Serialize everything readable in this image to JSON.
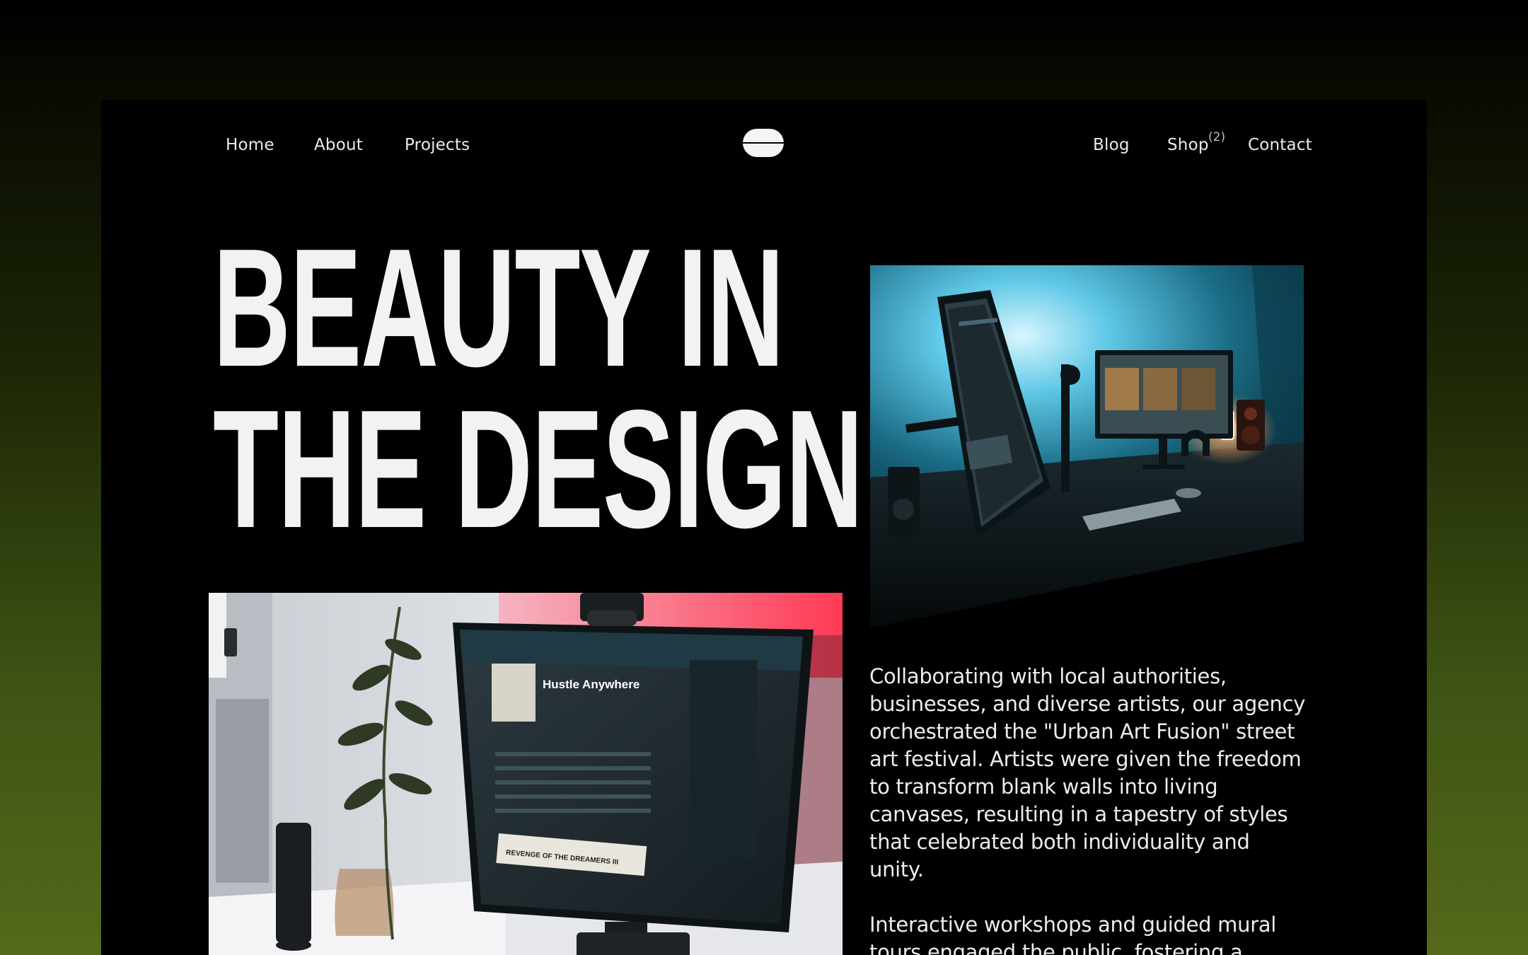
{
  "nav": {
    "home": "Home",
    "about": "About",
    "projects": "Projects",
    "blog": "Blog",
    "shop": "Shop",
    "shop_count": "(2)",
    "contact": "Contact"
  },
  "hero": {
    "line1": "BEAUTY IN",
    "line2": "THE DESIGN"
  },
  "body": {
    "paragraph1": "Collaborating with local authorities, businesses, and diverse artists, our agency orchestrated the \"Urban Art Fusion\" street art festival. Artists were given the freedom to transform blank walls into living canvases, resulting in a tapestry of styles that celebrated both individuality and unity.",
    "paragraph2": "Interactive workshops and guided mural tours engaged the public, fostering a"
  },
  "images": {
    "right": "desk-setup-blue-photo",
    "left": "monitor-music-app-photo",
    "screen_title": "Hustle Anywhere",
    "screen_banner": "REVENGE OF THE DREAMERS III"
  },
  "colors": {
    "background_top": "#000000",
    "background_bottom": "#54691a",
    "frame": "#000000",
    "text": "#f2f2f2"
  }
}
